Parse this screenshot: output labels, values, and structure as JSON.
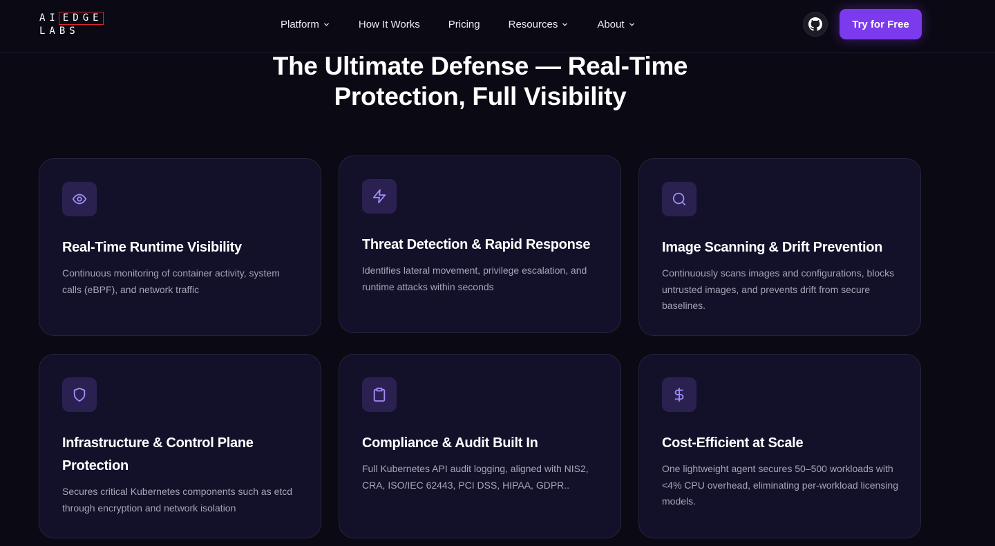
{
  "nav": {
    "logo_line1_a": "AI",
    "logo_line1_b": "EDGE",
    "logo_line2": "LABS",
    "items": [
      {
        "label": "Platform",
        "has_dropdown": true
      },
      {
        "label": "How It Works",
        "has_dropdown": false
      },
      {
        "label": "Pricing",
        "has_dropdown": false
      },
      {
        "label": "Resources",
        "has_dropdown": true
      },
      {
        "label": "About",
        "has_dropdown": true
      }
    ],
    "github_icon": "github-icon",
    "cta_label": "Try for Free"
  },
  "hero": {
    "heading_line1": "The Ultimate Defense — Real-Time",
    "heading_line2": "Protection, Full Visibility"
  },
  "cards": [
    {
      "icon": "eye-icon",
      "title": "Real-Time Runtime Visibility",
      "description": "Continuous monitoring of container activity, system calls (eBPF), and network traffic"
    },
    {
      "icon": "lightning-icon",
      "title": "Threat Detection & Rapid Response",
      "description": "Identifies lateral movement, privilege escalation, and runtime attacks within seconds"
    },
    {
      "icon": "search-icon",
      "title": "Image Scanning & Drift Prevention",
      "description": "Continuously scans images and configurations, blocks untrusted images, and prevents drift from secure baselines."
    },
    {
      "icon": "shield-icon",
      "title": "Infrastructure & Control Plane Protection",
      "description": "Secures critical Kubernetes components such as etcd through encryption and network isolation"
    },
    {
      "icon": "clipboard-icon",
      "title": "Compliance & Audit Built In",
      "description": "Full Kubernetes API audit logging, aligned with NIS2, CRA, ISO/IEC 62443, PCI DSS, HIPAA, GDPR.."
    },
    {
      "icon": "dollar-icon",
      "title": "Cost-Efficient at Scale",
      "description": "One lightweight agent secures 50–500 workloads with <4% CPU overhead, eliminating per-workload licensing models."
    }
  ],
  "colors": {
    "background": "#0b0913",
    "card_background": "#13112a",
    "accent": "#7c3aed",
    "icon_color": "#a78bfa",
    "logo_red": "#e0242c"
  }
}
